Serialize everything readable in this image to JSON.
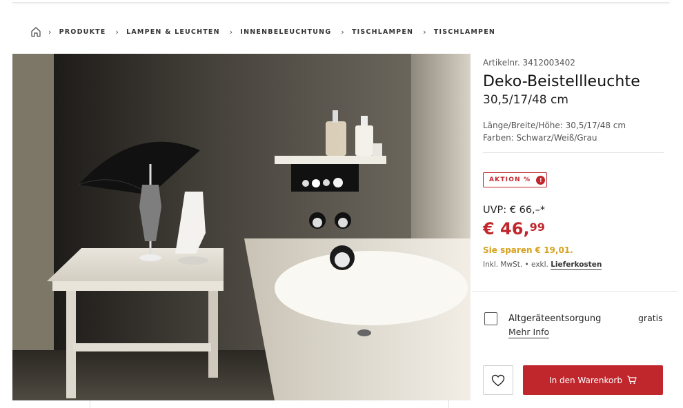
{
  "breadcrumb": {
    "items": [
      {
        "label": "PRODUKTE"
      },
      {
        "label": "LAMPEN & LEUCHTEN"
      },
      {
        "label": "INNENBELEUCHTUNG"
      },
      {
        "label": "TISCHLAMPEN"
      },
      {
        "label": "TISCHLAMPEN"
      }
    ]
  },
  "product": {
    "article_number": "Artikelnr. 3412003402",
    "title": "Deko-Beistellleuchte",
    "subtitle": "30,5/17/48 cm",
    "dimensions": "Länge/Breite/Höhe: 30,5/17/48 cm",
    "colors": "Farben: Schwarz/Weiß/Grau"
  },
  "badge": {
    "label": "AKTION %",
    "info": "!"
  },
  "pricing": {
    "uvp": "UVP: € 66,–*",
    "price_main": "€ 46,",
    "price_cents": "99",
    "savings": "Sie sparen € 19,01.",
    "tax_prefix": "Inkl. MwSt. • exkl. ",
    "shipping_link": "Lieferkosten"
  },
  "service": {
    "label": "Altgeräteentsorgung",
    "more_link": "Mehr Info",
    "price": "gratis",
    "checked": false
  },
  "actions": {
    "cart_label": "In den Warenkorb"
  },
  "colors": {
    "accent_red": "#c0272d",
    "savings_gold": "#d6a21e"
  },
  "icons": {
    "home": "home-icon",
    "breadcrumb_separator": "chevron-right-icon",
    "wishlist": "heart-icon",
    "cart": "shopping-cart-icon"
  }
}
